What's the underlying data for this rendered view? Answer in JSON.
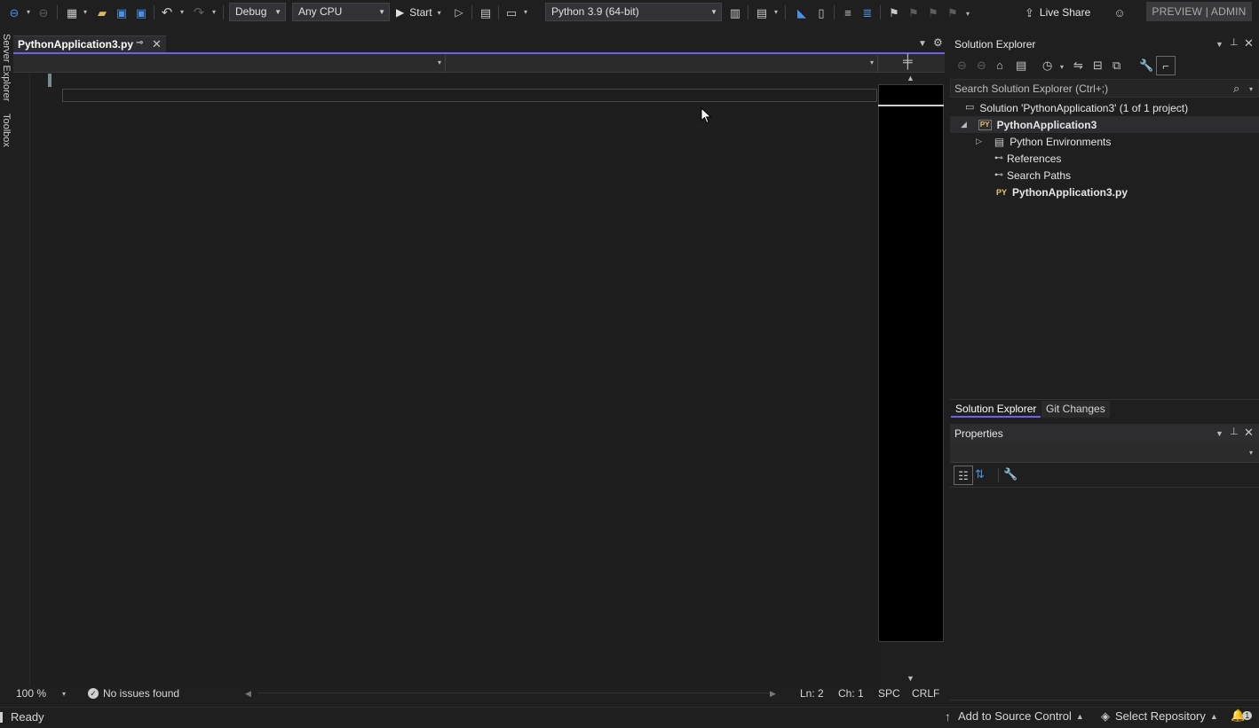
{
  "toolbar": {
    "config": "Debug",
    "platform": "Any CPU",
    "start_label": "Start",
    "python_env": "Python 3.9 (64-bit)",
    "live_share": "Live Share",
    "preview_admin": "PREVIEW | ADMIN"
  },
  "left_strip": {
    "server_explorer": "Server Explorer",
    "toolbox": "Toolbox"
  },
  "document": {
    "tab_title": "PythonApplication3.py"
  },
  "editor_status": {
    "zoom": "100 %",
    "issues": "No issues found",
    "line": "Ln: 2",
    "col": "Ch: 1",
    "spacing": "SPC",
    "line_ending": "CRLF"
  },
  "solution_explorer": {
    "title": "Solution Explorer",
    "search_placeholder": "Search Solution Explorer (Ctrl+;)",
    "tree": {
      "solution": "Solution 'PythonApplication3' (1 of 1 project)",
      "project": "PythonApplication3",
      "python_envs": "Python Environments",
      "references": "References",
      "search_paths": "Search Paths",
      "file": "PythonApplication3.py"
    },
    "tabs": [
      "Solution Explorer",
      "Git Changes"
    ]
  },
  "properties": {
    "title": "Properties"
  },
  "status_bar": {
    "ready": "Ready",
    "add_source_control": "Add to Source Control",
    "select_repository": "Select Repository",
    "notifications": "1"
  },
  "colors": {
    "accent": "#7160e8",
    "background": "#1f1f1f",
    "icon_blue": "#4a8fe0"
  }
}
